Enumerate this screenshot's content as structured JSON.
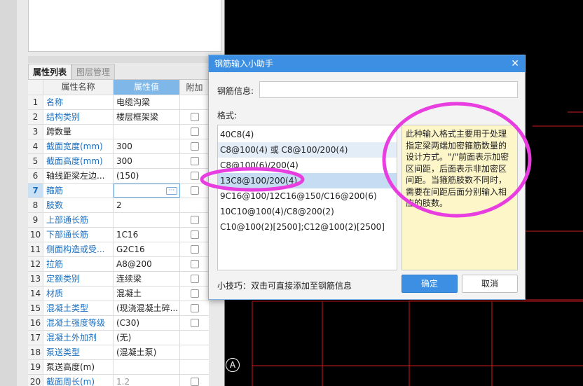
{
  "properties_panel": {
    "tabs": [
      "属性列表",
      "图层管理"
    ],
    "columns": {
      "name": "属性名称",
      "value": "属性值",
      "extra": "附加"
    },
    "rows": [
      {
        "idx": "1",
        "name": "名称",
        "value": "电缆沟梁",
        "name_style": "blue",
        "checkbox": false
      },
      {
        "idx": "2",
        "name": "结构类别",
        "value": "楼层框架梁",
        "name_style": "blue",
        "checkbox": true
      },
      {
        "idx": "3",
        "name": "跨数量",
        "value": "",
        "name_style": "black",
        "checkbox": true
      },
      {
        "idx": "4",
        "name": "截面宽度(mm)",
        "value": "300",
        "name_style": "blue",
        "checkbox": true
      },
      {
        "idx": "5",
        "name": "截面高度(mm)",
        "value": "300",
        "name_style": "blue",
        "checkbox": true
      },
      {
        "idx": "6",
        "name": "轴线距梁左边...",
        "value": "(150)",
        "name_style": "black",
        "checkbox": true
      },
      {
        "idx": "7",
        "name": "箍筋",
        "value": "",
        "name_style": "blue",
        "checkbox": true,
        "selected": true,
        "has_button": true,
        "button_label": "···"
      },
      {
        "idx": "8",
        "name": "肢数",
        "value": "2",
        "name_style": "blue",
        "checkbox": false
      },
      {
        "idx": "9",
        "name": "上部通长筋",
        "value": "",
        "name_style": "blue",
        "checkbox": true
      },
      {
        "idx": "10",
        "name": "下部通长筋",
        "value": "1C16",
        "name_style": "blue",
        "checkbox": true
      },
      {
        "idx": "11",
        "name": "侧面构造或受...",
        "value": "G2C16",
        "name_style": "blue",
        "checkbox": true
      },
      {
        "idx": "12",
        "name": "拉筋",
        "value": "A8@200",
        "name_style": "blue",
        "checkbox": true
      },
      {
        "idx": "13",
        "name": "定额类别",
        "value": "连续梁",
        "name_style": "blue",
        "checkbox": true
      },
      {
        "idx": "14",
        "name": "材质",
        "value": "混凝土",
        "name_style": "blue",
        "checkbox": true
      },
      {
        "idx": "15",
        "name": "混凝土类型",
        "value": "(现浇混凝土碎...",
        "name_style": "blue",
        "checkbox": true
      },
      {
        "idx": "16",
        "name": "混凝土强度等级",
        "value": "(C30)",
        "name_style": "blue",
        "checkbox": true
      },
      {
        "idx": "17",
        "name": "混凝土外加剂",
        "value": "(无)",
        "name_style": "blue",
        "checkbox": false
      },
      {
        "idx": "18",
        "name": "泵送类型",
        "value": "(混凝土泵)",
        "name_style": "blue",
        "checkbox": false
      },
      {
        "idx": "19",
        "name": "泵送高度(m)",
        "value": "",
        "name_style": "black",
        "checkbox": false
      },
      {
        "idx": "20",
        "name": "截面周长(m)",
        "value": "1.2",
        "name_style": "blue",
        "value_style": "gray",
        "checkbox": true
      }
    ]
  },
  "dialog": {
    "title": "钢筋输入小助手",
    "close_icon": "close-icon",
    "info_label": "钢筋信息:",
    "info_value": "",
    "format_label": "格式:",
    "formats": [
      "40C8(4)",
      "C8@100(4) 或 C8@100/200(4)",
      "C8@100(6)/200(4)",
      "13C8@100/200(4)",
      "9C16@100/12C16@150/C16@200(6)",
      "10C10@100(4)/C8@200(2)",
      "C10@100(2)[2500];C12@100(2)[2500]"
    ],
    "highlighted_index": 3,
    "hovered_index": 1,
    "description": "此种输入格式主要用于处理指定梁两端加密箍筋数量的设计方式。\"/\"前面表示加密区间距，后面表示非加密区间距。当箍筋肢数不同时，需要在间距后面分别输入相应的肢数。",
    "tip": "小技巧：双击可直接添加至钢筋信息",
    "ok_label": "确定",
    "cancel_label": "取消"
  },
  "canvas": {
    "axis_label": "A",
    "line_color": "#d11b1b",
    "annotation_color": "#e83ee0"
  }
}
